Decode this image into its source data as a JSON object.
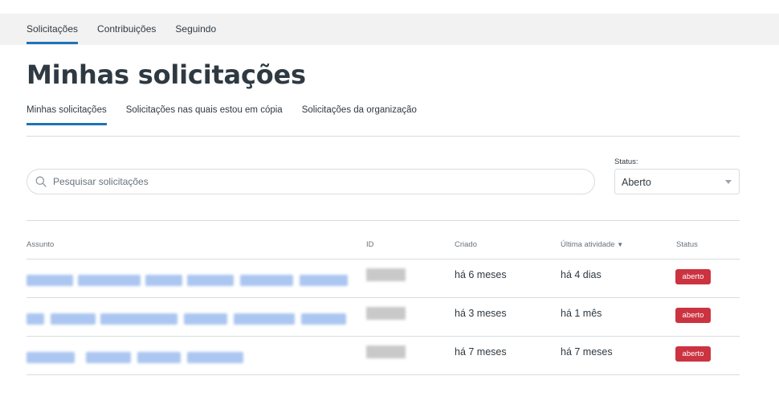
{
  "top_nav": {
    "items": [
      {
        "label": "Solicitações",
        "active": true
      },
      {
        "label": "Contribuições",
        "active": false
      },
      {
        "label": "Seguindo",
        "active": false
      }
    ]
  },
  "page": {
    "title": "Minhas solicitações"
  },
  "sub_tabs": {
    "items": [
      {
        "label": "Minhas solicitações",
        "active": true
      },
      {
        "label": "Solicitações nas quais estou em cópia",
        "active": false
      },
      {
        "label": "Solicitações da organização",
        "active": false
      }
    ]
  },
  "search": {
    "placeholder": "Pesquisar solicitações",
    "value": "",
    "icon": "search-icon"
  },
  "status_filter": {
    "label": "Status:",
    "value": "Aberto",
    "icon": "chevron-down-icon"
  },
  "table": {
    "columns": [
      "Assunto",
      "ID",
      "Criado",
      "Última atividade",
      "Status"
    ],
    "sort_indicator": "▼",
    "rows": [
      {
        "created": "há 6 meses",
        "last_activity": "há 4 dias",
        "status": "aberto"
      },
      {
        "created": "há 3 meses",
        "last_activity": "há 1 mês",
        "status": "aberto"
      },
      {
        "created": "há 7 meses",
        "last_activity": "há 7 meses",
        "status": "aberto"
      }
    ]
  },
  "colors": {
    "accent": "#1f73b7",
    "status_open": "#cc3340",
    "topbar_bg": "#f2f2f2",
    "redacted_link": "#8fb3eb"
  }
}
